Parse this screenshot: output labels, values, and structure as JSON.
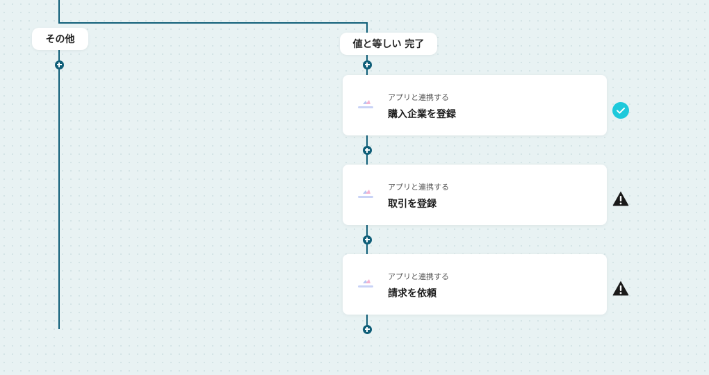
{
  "branches": [
    {
      "label": "その他"
    },
    {
      "label": "値と等しい 完了"
    }
  ],
  "steps": [
    {
      "type_label": "アプリと連携する",
      "title": "購入企業を登録",
      "status": "success",
      "status_icon": "check-circle-icon"
    },
    {
      "type_label": "アプリと連携する",
      "title": "取引を登録",
      "status": "warning",
      "status_icon": "warning-icon"
    },
    {
      "type_label": "アプリと連携する",
      "title": "請求を依頼",
      "status": "warning",
      "status_icon": "warning-icon"
    }
  ],
  "colors": {
    "flow_line": "#0f5e78",
    "success": "#1ec9db",
    "warning": "#1a1a1a",
    "background": "#e8f2f3"
  }
}
